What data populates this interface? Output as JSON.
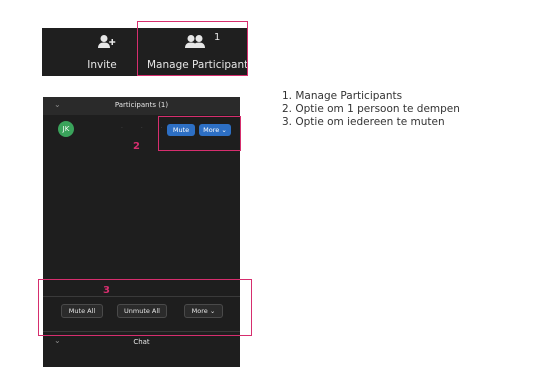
{
  "toolbar": {
    "invite_label": "Invite",
    "manage_label": "Manage Participant",
    "participant_count": "1",
    "icons": {
      "invite": "add-person-icon",
      "manage": "participants-icon"
    }
  },
  "panel": {
    "title": "Participants (1)",
    "participant": {
      "initials": "JK",
      "avatar_color": "#3aa35b"
    },
    "mute_label": "Mute",
    "more_label": "More ⌄",
    "mute_all_label": "Mute All",
    "unmute_all_label": "Unmute All",
    "more_bottom_label": "More ⌄",
    "chat_label": "Chat"
  },
  "annotations": {
    "color": "#d62e6e",
    "box2_number": "2",
    "box3_number": "3"
  },
  "legend": {
    "items": [
      "1. Manage Participants",
      "2. Optie om 1 persoon te dempen",
      "3. Optie om iedereen te muten"
    ]
  }
}
